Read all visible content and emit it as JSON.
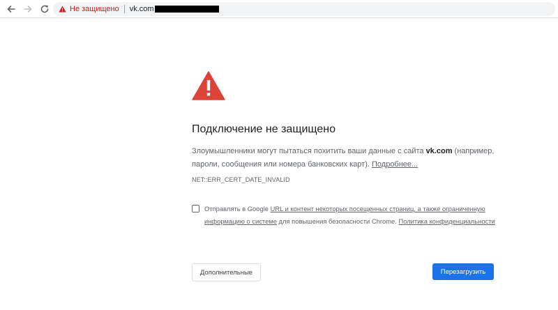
{
  "browser": {
    "security_label": "Не защищено",
    "url": "vk.com",
    "url_redacted": true,
    "icons": {
      "back": "arrow-left-icon",
      "forward": "arrow-right-icon",
      "reload": "reload-icon",
      "security": "warning-triangle-icon"
    }
  },
  "interstitial": {
    "icon": "warning-triangle-icon",
    "title": "Подключение не защищено",
    "explanation_before": "Злоумышленники могут пытаться похитить ваши данные с сайта ",
    "explanation_domain": "vk.com",
    "explanation_after": " (например, пароли, сообщения или номера банковских карт). ",
    "more_link": "Подробнее...",
    "error_code": "NET::ERR_CERT_DATE_INVALID",
    "optin": {
      "checked": false,
      "text_1": "Отправлять в Google ",
      "link_1": "URL и контент некоторых посещенных страниц, а также ограниченную информацию о системе",
      "text_2": " для повышения безопасности Chrome. ",
      "link_2": "Политика конфиденциальности"
    },
    "advanced_button": "Дополнительные",
    "reload_button": "Перезагрузить"
  },
  "colors": {
    "warning_red": "#db4437",
    "primary_blue": "#1a73e8",
    "not_secure_text": "#c5221f"
  }
}
